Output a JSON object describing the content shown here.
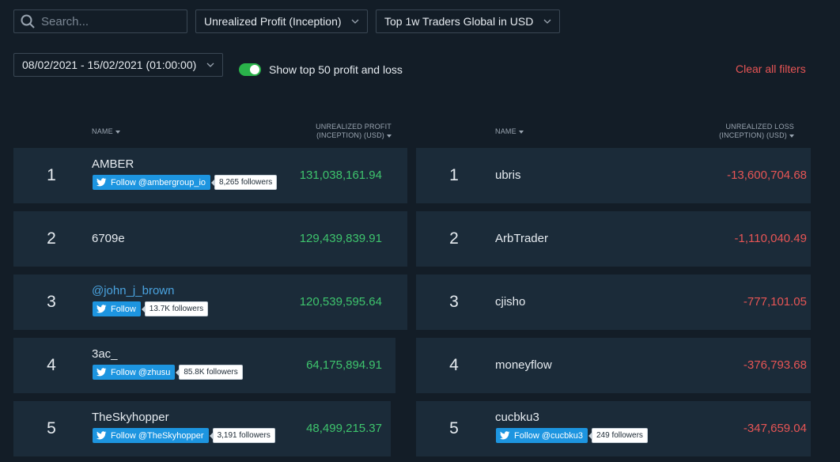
{
  "search": {
    "placeholder": "Search..."
  },
  "filters": {
    "metric": "Unrealized Profit (Inception)",
    "scope": "Top 1w Traders Global in USD",
    "date_range": "08/02/2021 - 15/02/2021 (01:00:00)",
    "toggle_label": "Show top 50 profit and loss",
    "toggle_on": true,
    "clear_label": "Clear all filters"
  },
  "profit_table": {
    "name_header": "NAME",
    "value_header_1": "UNREALIZED PROFIT",
    "value_header_2": "(INCEPTION) (USD)",
    "rows": [
      {
        "rank": "1",
        "name": "AMBER",
        "value": "131,038,161.94",
        "follow": "Follow @ambergroup_io",
        "followers": "8,265 followers"
      },
      {
        "rank": "2",
        "name": "6709e",
        "value": "129,439,839.91"
      },
      {
        "rank": "3",
        "name": "@john_j_brown",
        "value": "120,539,595.64",
        "follow": "Follow",
        "followers": "13.7K followers"
      },
      {
        "rank": "4",
        "name": "3ac_",
        "value": "64,175,894.91",
        "follow": "Follow @zhusu",
        "followers": "85.8K followers"
      },
      {
        "rank": "5",
        "name": "TheSkyhopper",
        "value": "48,499,215.37",
        "follow": "Follow @TheSkyhopper",
        "followers": "3,191 followers"
      }
    ]
  },
  "loss_table": {
    "name_header": "NAME",
    "value_header_1": "UNREALIZED LOSS",
    "value_header_2": "(INCEPTION) (USD)",
    "rows": [
      {
        "rank": "1",
        "name": "ubris",
        "value": "-13,600,704.68"
      },
      {
        "rank": "2",
        "name": "ArbTrader",
        "value": "-1,110,040.49"
      },
      {
        "rank": "3",
        "name": "cjisho",
        "value": "-777,101.05"
      },
      {
        "rank": "4",
        "name": "moneyflow",
        "value": "-376,793.68"
      },
      {
        "rank": "5",
        "name": "cucbku3",
        "value": "-347,659.04",
        "follow": "Follow @cucbku3",
        "followers": "249 followers"
      }
    ]
  },
  "colors": {
    "background": "#131d27",
    "row": "#1b2b39",
    "profit": "#3ec46d",
    "loss": "#e75555",
    "twitter": "#1d95e0",
    "toggle": "#2ab34a"
  }
}
